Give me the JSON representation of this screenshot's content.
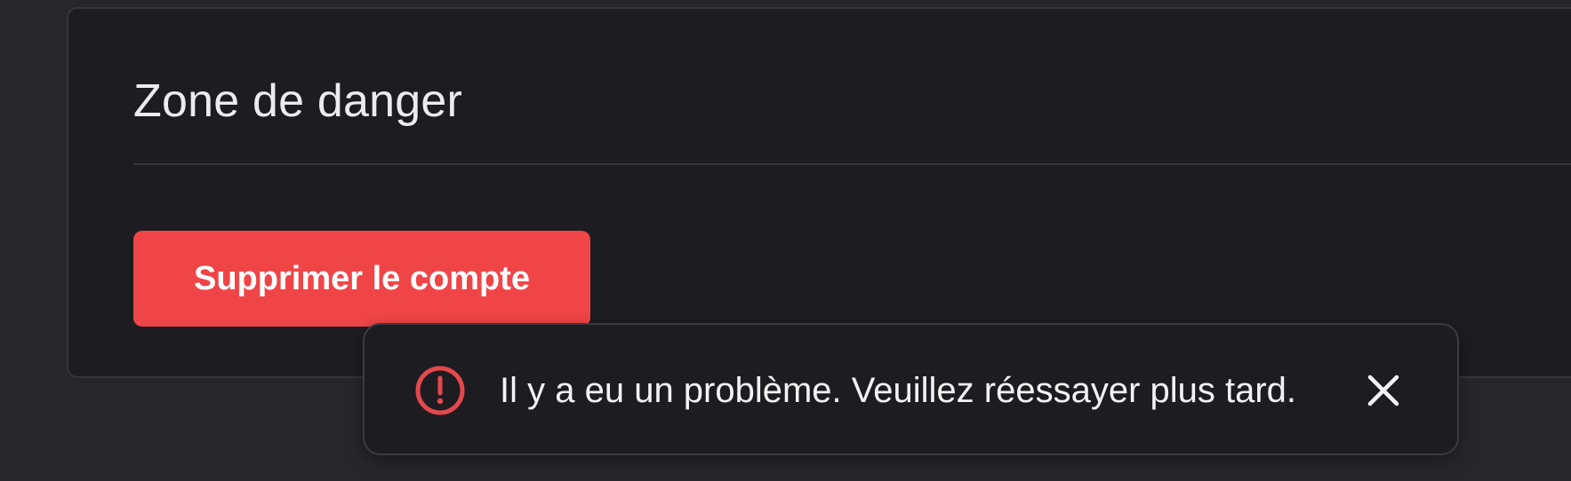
{
  "danger_zone": {
    "title": "Zone de danger",
    "delete_button_label": "Supprimer le compte",
    "button_color": "#f04547"
  },
  "toast": {
    "type": "error",
    "icon": "alert-circle-icon",
    "message": "Il y a eu un problème. Veuillez réessayer plus tard.",
    "close_icon": "close-icon",
    "icon_color": "#e5484d"
  }
}
